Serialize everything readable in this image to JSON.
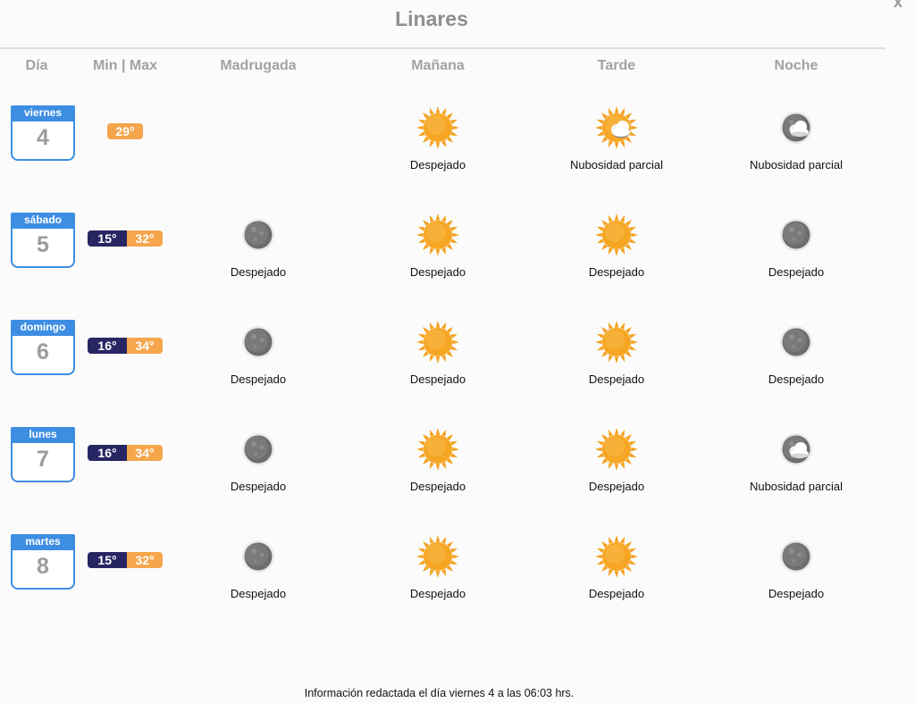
{
  "title": "Linares",
  "close_label": "x",
  "columns": {
    "dia": "Día",
    "minmax": "Min | Max",
    "madrugada": "Madrugada",
    "manana": "Mañana",
    "tarde": "Tarde",
    "noche": "Noche"
  },
  "days": [
    {
      "weekday": "viernes",
      "day": "4",
      "min": "",
      "max": "29°",
      "madrugada": {
        "icon": "",
        "desc": ""
      },
      "manana": {
        "icon": "sun-icon",
        "desc": "Despejado"
      },
      "tarde": {
        "icon": "sun-cloud-icon",
        "desc": "Nubosidad parcial"
      },
      "noche": {
        "icon": "moon-cloud-icon",
        "desc": "Nubosidad parcial"
      }
    },
    {
      "weekday": "sábado",
      "day": "5",
      "min": "15°",
      "max": "32°",
      "madrugada": {
        "icon": "moon-icon",
        "desc": "Despejado"
      },
      "manana": {
        "icon": "sun-icon",
        "desc": "Despejado"
      },
      "tarde": {
        "icon": "sun-icon",
        "desc": "Despejado"
      },
      "noche": {
        "icon": "moon-icon",
        "desc": "Despejado"
      }
    },
    {
      "weekday": "domingo",
      "day": "6",
      "min": "16°",
      "max": "34°",
      "madrugada": {
        "icon": "moon-icon",
        "desc": "Despejado"
      },
      "manana": {
        "icon": "sun-icon",
        "desc": "Despejado"
      },
      "tarde": {
        "icon": "sun-icon",
        "desc": "Despejado"
      },
      "noche": {
        "icon": "moon-icon",
        "desc": "Despejado"
      }
    },
    {
      "weekday": "lunes",
      "day": "7",
      "min": "16°",
      "max": "34°",
      "madrugada": {
        "icon": "moon-icon",
        "desc": "Despejado"
      },
      "manana": {
        "icon": "sun-icon",
        "desc": "Despejado"
      },
      "tarde": {
        "icon": "sun-icon",
        "desc": "Despejado"
      },
      "noche": {
        "icon": "moon-cloud-icon",
        "desc": "Nubosidad parcial"
      }
    },
    {
      "weekday": "martes",
      "day": "8",
      "min": "15°",
      "max": "32°",
      "madrugada": {
        "icon": "moon-icon",
        "desc": "Despejado"
      },
      "manana": {
        "icon": "sun-icon",
        "desc": "Despejado"
      },
      "tarde": {
        "icon": "sun-icon",
        "desc": "Despejado"
      },
      "noche": {
        "icon": "moon-icon",
        "desc": "Despejado"
      }
    }
  ],
  "footer": "Información redactada el día viernes 4 a las 06:03 hrs.",
  "colors": {
    "calendar_blue": "#3d8ee3",
    "min_badge": "#272662",
    "max_badge": "#f5a64d",
    "sun": "#f6a623",
    "moon": "#6a6a6a"
  }
}
